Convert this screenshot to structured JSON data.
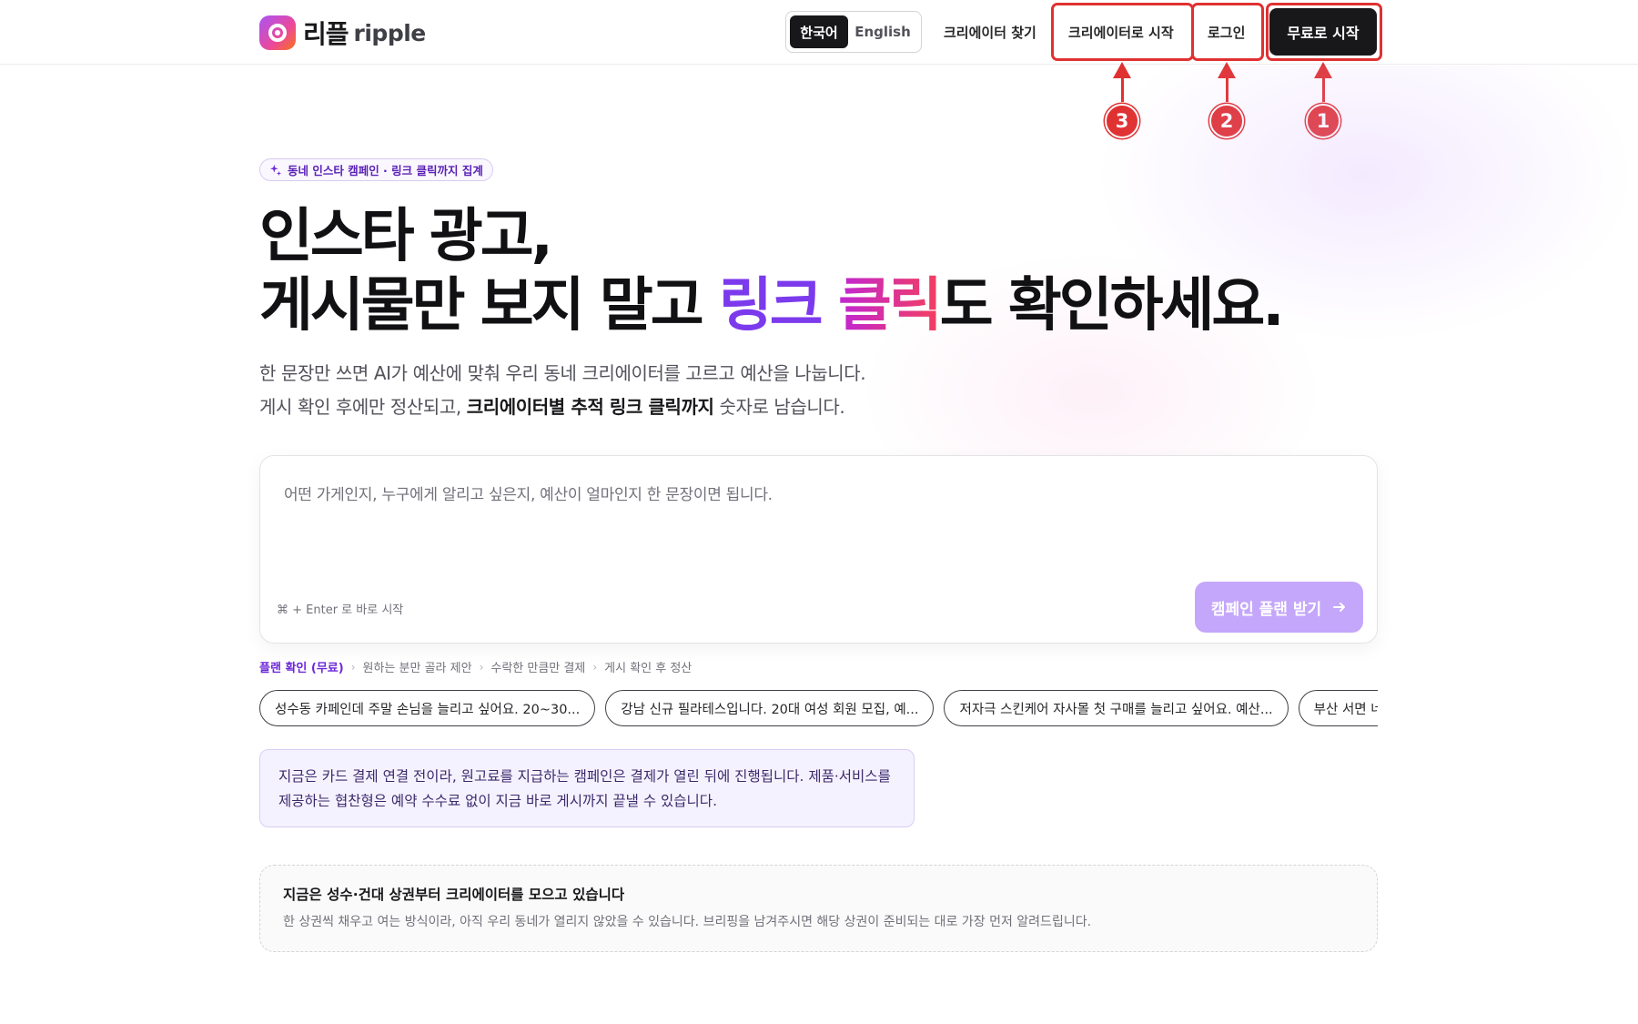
{
  "header": {
    "logo_ko": "리플",
    "logo_en": "ripple",
    "lang_ko": "한국어",
    "lang_en": "English",
    "find_creator": "크리에이터 찾기",
    "start_as_creator": "크리에이터로 시작",
    "login": "로그인",
    "start_free": "무료로 시작"
  },
  "annotations": {
    "num_1": "1",
    "num_2": "2",
    "num_3": "3"
  },
  "hero": {
    "chip": "동네 인스타 캠페인 · 링크 클릭까지 집계",
    "title_line1": "인스타 광고,",
    "title_line2_a": "게시물만 보지 말고 ",
    "title_line2_b": "링크",
    "title_line2_space": " ",
    "title_line2_c": "클릭",
    "title_line2_d": "도 확인하세요.",
    "sub_line1": "한 문장만 쓰면 AI가 예산에 맞춰 우리 동네 크리에이터를 고르고 예산을 나눕니다.",
    "sub_line2_a": "게시 확인 후에만 정산되고, ",
    "sub_line2_b": "크리에이터별 추적 링크 클릭까지",
    "sub_line2_c": " 숫자로 남습니다."
  },
  "prompt": {
    "placeholder": "어떤 가게인지, 누구에게 알리고 싶은지, 예산이 얼마인지 한 문장이면 됩니다.",
    "hint": "⌘ + Enter 로 바로 시작",
    "submit": "캠페인 플랜 받기"
  },
  "steps": [
    "플랜 확인 (무료)",
    "원하는 분만 골라 제안",
    "수락한 만큼만 결제",
    "게시 확인 후 정산"
  ],
  "examples": [
    "성수동 카페인데 주말 손님을 늘리고 싶어요. 20~30...",
    "강남 신규 필라테스입니다. 20대 여성 회원 모집, 예...",
    "저자극 스킨케어 자사몰 첫 구매를 늘리고 싶어요. 예산...",
    "부산 서면 네일샵 신"
  ],
  "notice": {
    "text": "지금은 카드 결제 연결 전이라, 원고료를 지급하는 캠페인은 결제가 열린 뒤에 진행됩니다. 제품·서비스를 제공하는 협찬형은 예약 수수료 없이 지금 바로 게시까지 끝낼 수 있습니다."
  },
  "coverage": {
    "title": "지금은 성수·건대 상권부터 크리에이터를 모으고 있습니다",
    "desc": "한 상권씩 채우고 여는 방식이라, 아직 우리 동네가 열리지 않았을 수 있습니다. 브리핑을 남겨주시면 해당 상권이 준비되는 대로 가장 먼저 알려드립니다."
  },
  "colors": {
    "accent": "#7c3aed",
    "annotation": "#e03131",
    "submit": "#c4a7fb"
  }
}
